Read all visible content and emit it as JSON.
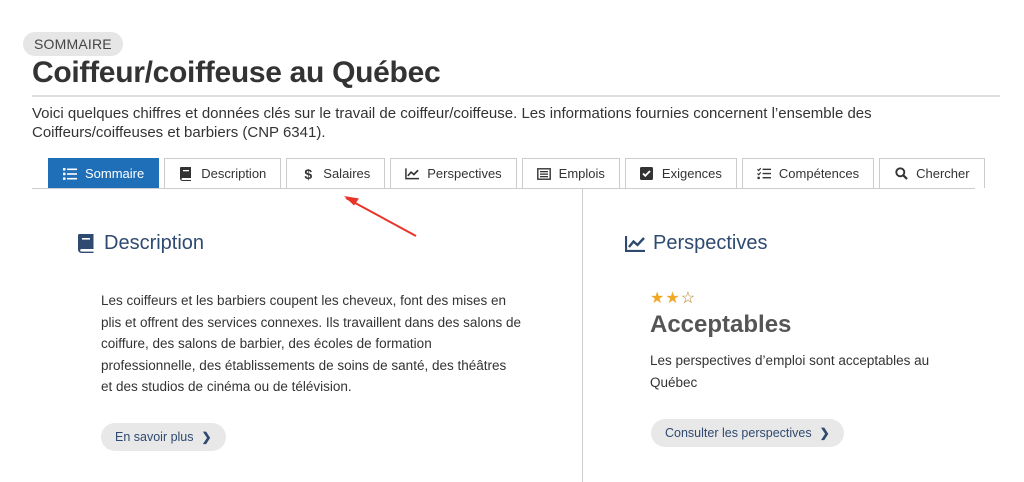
{
  "header": {
    "badge": "SOMMAIRE",
    "title": "Coiffeur/coiffeuse au Québec",
    "intro": "Voici quelques chiffres et données clés sur le travail de coiffeur/coiffeuse. Les informations fournies concernent l’ensemble des Coiffeurs/coiffeuses et barbiers (CNP 6341)."
  },
  "tabs": [
    {
      "label": "Sommaire",
      "icon": "list-icon",
      "active": true
    },
    {
      "label": "Description",
      "icon": "book-icon",
      "active": false
    },
    {
      "label": "Salaires",
      "icon": "dollar-icon",
      "active": false
    },
    {
      "label": "Perspectives",
      "icon": "chart-line-icon",
      "active": false
    },
    {
      "label": "Emplois",
      "icon": "newspaper-icon",
      "active": false
    },
    {
      "label": "Exigences",
      "icon": "checkbox-icon",
      "active": false
    },
    {
      "label": "Compétences",
      "icon": "checklist-icon",
      "active": false
    },
    {
      "label": "Chercher",
      "icon": "search-icon",
      "active": false
    }
  ],
  "description": {
    "title": "Description",
    "text": "Les coiffeurs et les barbiers coupent les cheveux, font des mises en plis et offrent des services connexes. Ils travaillent dans des salons de coiffure, des salons de barbier, des écoles de formation professionnelle, des établissements de soins de santé, des théâtres et des studios de cinéma ou de télévision.",
    "button": "En savoir plus"
  },
  "perspectives": {
    "title": "Perspectives",
    "stars_filled": 2,
    "stars_total": 3,
    "rating": "Acceptables",
    "text": "Les perspectives d’emploi sont acceptables au Québec",
    "button": "Consulter les perspectives"
  },
  "colors": {
    "accent": "#1f6fb8",
    "heading": "#2e4a70",
    "star": "#f0a828",
    "annotation_arrow": "#e8352a"
  }
}
